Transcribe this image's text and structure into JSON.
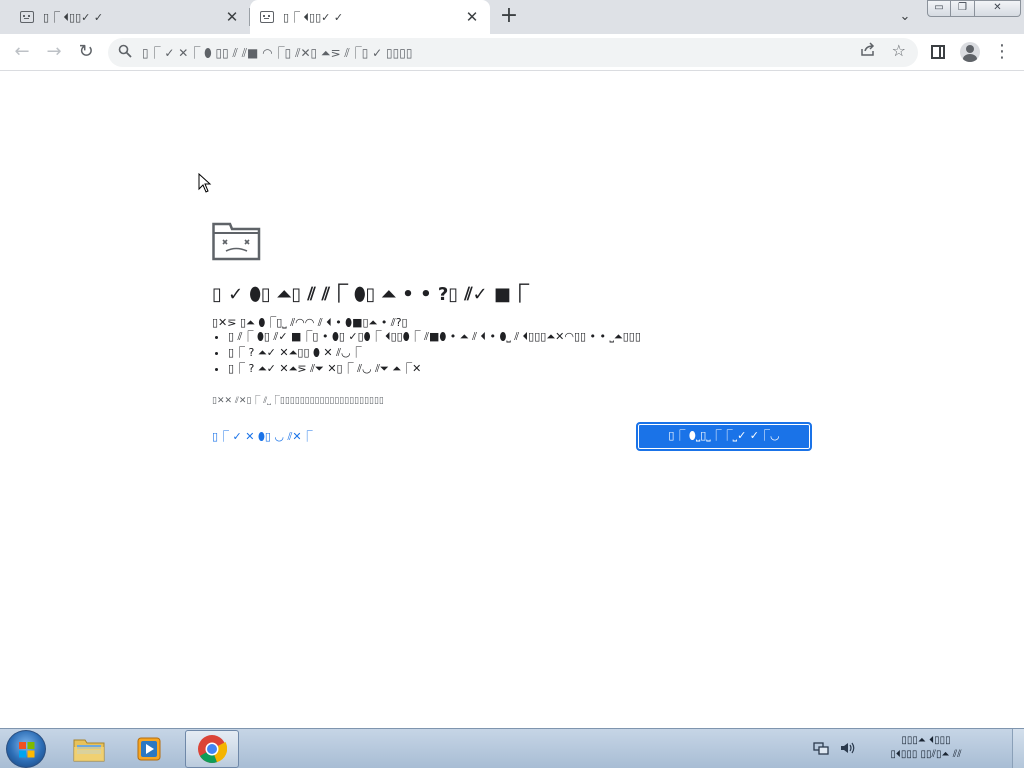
{
  "browser": {
    "tabs": [
      {
        "title": "▯⎾ ⏴▯▯✓ ✓",
        "active": false,
        "close_label": "✕"
      },
      {
        "title": "▯⎾ ⏴▯▯✓ ✓",
        "active": true,
        "close_label": "✕"
      }
    ],
    "new_tab_label": "+",
    "tab_search_label": "⌄",
    "window_controls": {
      "minimize": "▭",
      "maximize": "❐",
      "close": "✕"
    },
    "nav": {
      "back": "←",
      "forward": "→",
      "reload": "↻"
    },
    "omnibox": {
      "icon": "search-icon",
      "text": "▯⎾ ✓ ✕⎾ ⬮ ▯▯ ⫽ ⫽■ ◠⎾▯ ⫽✕▯ ⏶⋝ ⫽⎾▯ ✓ ▯▯▯▯"
    }
  },
  "page": {
    "heading": "▯ ✓ ⬮▯ ⏶▯ ⫽ ⫽⎾ ⬮▯ ⏶ • • ?▯ ⫽✓ ■⎾",
    "try_label": "▯✕⋝ ▯⏶ ⬮⎾▯⎵ ⫽◠◠ ⫽ ⏴ • ⬮■▯⏶ • ⫽?▯",
    "suggestions": [
      "▯ ⫽⎾ ⬮▯ ⫽✓ ■⎾▯ • ⬮▯ ✓▯⬮⎾ ⏴▯▯⬮⎾ ⫽■⬮ • ⏶ ⫽ ⏴ • ⬮⎵ ⫽ ⏴▯▯▯⏶✕◠▯▯ • • ⎵⏶▯▯▯",
      "▯⎾ ? ⏶✓ ✕⏶▯▯ ⬮ ✕ ⫽◡⎾",
      "▯⎾ ? ⏶✓ ✕⏶⋝ ⫽⏷ ✕▯⎾ ⫽◡ ⫽⏷ ⏶⎾✕"
    ],
    "error_code": "▯✕✕ ⫽✕▯⎾ ⫽⎵⎾▯▯▯▯▯▯▯▯▯▯▯▯▯▯▯▯▯▯▯▯▯",
    "details_label": "▯⎾ ✓ ✕ ⬮▯ ◡ ⫽✕⎾",
    "reload_label": "▯⎾ ⬮⎵▯⎵⎾⎾⎵✓ ✓⎾◡"
  },
  "taskbar": {
    "apps": [
      "windows-explorer-icon",
      "media-player-icon",
      "chrome-icon"
    ],
    "active_app": "chrome-icon",
    "clock_time": "▯▯▯⏶ ⏴▯▯▯",
    "clock_date": "▯⏴▯▯▯ ▯▯⫽▯⏶ ⫽⫽"
  },
  "colors": {
    "link": "#1a73e8",
    "button": "#1a73e8",
    "tabstrip": "#dee1e6",
    "omnibox": "#f1f3f4"
  }
}
